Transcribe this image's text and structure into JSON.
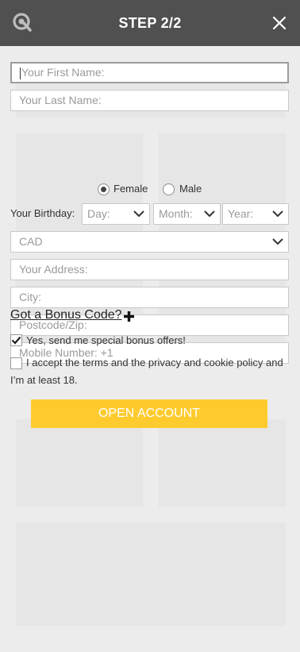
{
  "header": {
    "title": "STEP 2/2",
    "logo_icon": "brand-q-logo-icon",
    "close_icon": "close-icon"
  },
  "fields": {
    "first_name_placeholder": "Your First Name:",
    "last_name_placeholder": "Your Last Name:",
    "address_placeholder": "Your Address:",
    "city_placeholder": "City:",
    "postcode_placeholder": "Postcode/Zip:",
    "mobile_placeholder": "Mobile Number: +1"
  },
  "gender": {
    "female_label": "Female",
    "male_label": "Male",
    "selected": "Female"
  },
  "birthday": {
    "label": "Your Birthday:",
    "day": "Day:",
    "month": "Month:",
    "year": "Year:"
  },
  "currency": {
    "value": "CAD"
  },
  "bonus": {
    "link_text": "Got a Bonus Code?",
    "icon": "plus-icon"
  },
  "checkboxes": {
    "offers_label": "Yes, send me special bonus offers!",
    "offers_checked": true,
    "terms_label": "I accept the terms and the privacy and cookie policy and I’m at least 18.",
    "terms_checked": false
  },
  "cta": {
    "label": "OPEN ACCOUNT",
    "color": "#fecb2f"
  },
  "colors": {
    "header": "#505050",
    "background": "#ececec"
  }
}
